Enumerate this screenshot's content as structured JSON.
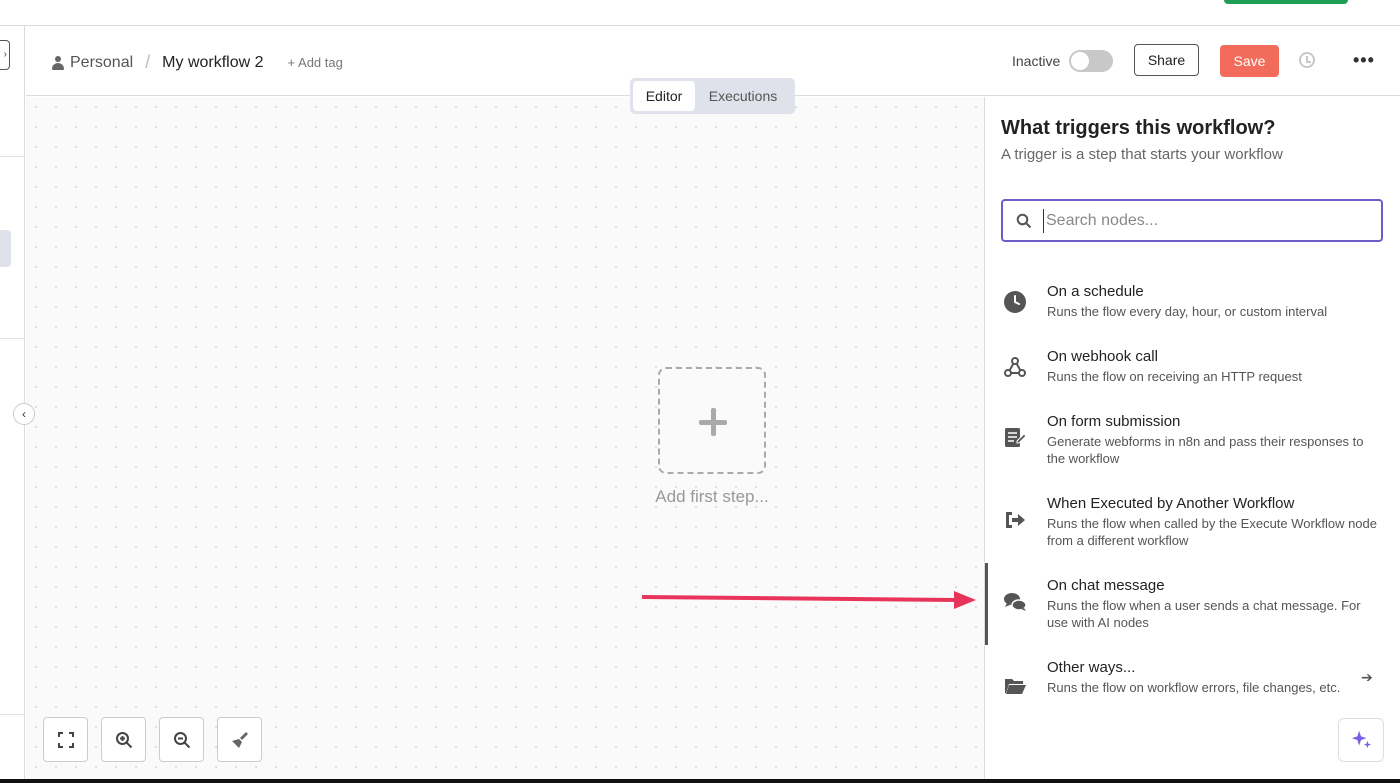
{
  "header": {
    "breadcrumb_personal": "Personal",
    "breadcrumb_sep": "/",
    "workflow_name": "My workflow 2",
    "add_tag": "+ Add tag",
    "status_label": "Inactive",
    "share_label": "Share",
    "save_label": "Save"
  },
  "tabs": [
    {
      "label": "Editor",
      "active": true
    },
    {
      "label": "Executions",
      "active": false
    }
  ],
  "canvas": {
    "add_first_step": "Add first step..."
  },
  "panel": {
    "title": "What triggers this workflow?",
    "subtitle": "A trigger is a step that starts your workflow",
    "search_placeholder": "Search nodes...",
    "items": [
      {
        "title": "On a schedule",
        "desc": "Runs the flow every day, hour, or custom interval",
        "icon": "clock-icon"
      },
      {
        "title": "On webhook call",
        "desc": "Runs the flow on receiving an HTTP request",
        "icon": "webhook-icon"
      },
      {
        "title": "On form submission",
        "desc": "Generate webforms in n8n and pass their responses to the workflow",
        "icon": "form-icon"
      },
      {
        "title": "When Executed by Another Workflow",
        "desc": "Runs the flow when called by the Execute Workflow node from a different workflow",
        "icon": "sign-in-icon"
      },
      {
        "title": "On chat message",
        "desc": "Runs the flow when a user sends a chat message. For use with AI nodes",
        "icon": "chat-icon"
      },
      {
        "title": "Other ways...",
        "desc": "Runs the flow on workflow errors, file changes, etc.",
        "icon": "folder-icon"
      }
    ]
  },
  "colors": {
    "save": "#f26b5b",
    "accent": "#6b5fc7",
    "arrow": "#e8345a"
  }
}
